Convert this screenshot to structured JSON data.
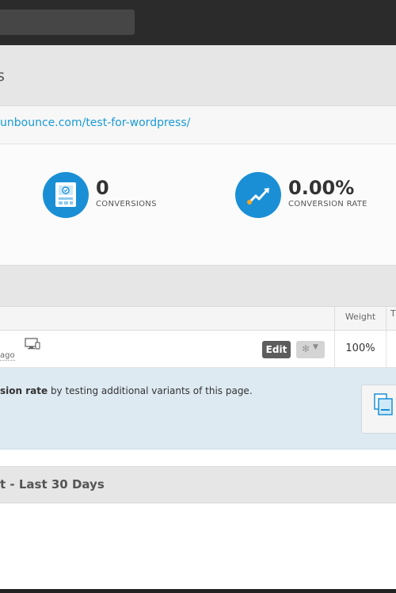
{
  "header": {
    "title_fragment": "s"
  },
  "page": {
    "url": "unbounce.com/test-for-wordpress/"
  },
  "stats": {
    "conversions": {
      "value": "0",
      "label": "CONVERSIONS",
      "icon": "form-icon"
    },
    "conversion_rate": {
      "value": "0.00%",
      "label": "CONVERSION RATE",
      "icon": "trend-line-icon"
    }
  },
  "table": {
    "weight_header": "Weight",
    "next_header_fragment": "T"
  },
  "variant": {
    "updated_fragment": "ago",
    "edit_label": "Edit",
    "weight": "100%"
  },
  "tip": {
    "bold_part": "sion rate",
    "rest": " by testing additional variants of this page."
  },
  "report": {
    "title_fragment": "t - Last 30 Days"
  },
  "colors": {
    "accent": "#1a8fd6",
    "link": "#1a9ad6",
    "tip_bg": "#deeaf2"
  }
}
